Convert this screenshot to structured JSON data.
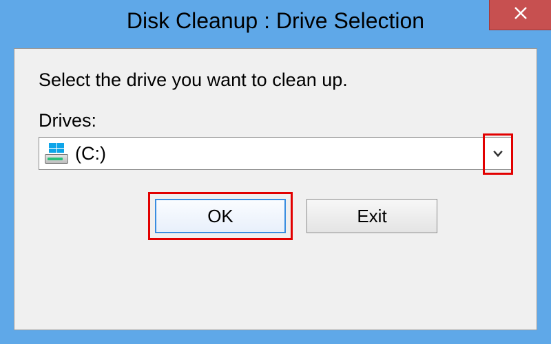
{
  "titlebar": {
    "title": "Disk Cleanup : Drive Selection",
    "close_icon": "close-icon"
  },
  "dialog": {
    "instruction": "Select the drive you want to clean up.",
    "drives_label": "Drives:",
    "selected_drive": "(C:)"
  },
  "buttons": {
    "ok_label": "OK",
    "exit_label": "Exit"
  }
}
